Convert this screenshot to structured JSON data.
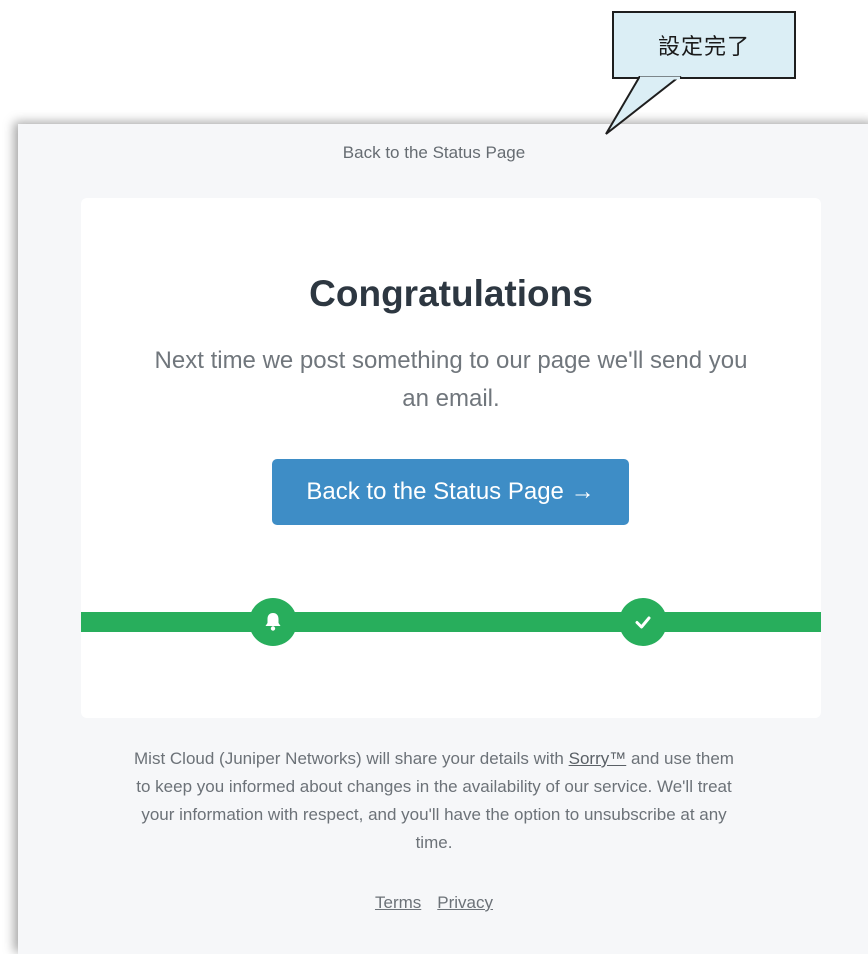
{
  "annotation": {
    "label": "設定完了"
  },
  "header": {
    "back_link": "Back to the Status Page"
  },
  "card": {
    "title": "Congratulations",
    "message": "Next time we post something to our page we'll send you an email.",
    "button_label": "Back to the Status Page →"
  },
  "progress": {
    "color": "#28ae5c",
    "steps": [
      {
        "icon": "bell-icon"
      },
      {
        "icon": "check-icon"
      }
    ]
  },
  "footer": {
    "text_before": "Mist Cloud (Juniper Networks) will share your details with ",
    "sorry_link": "Sorry™",
    "text_after": " and use them to keep you informed about changes in the availability of our service. We'll treat your information with respect, and you'll have the option to unsubscribe at any time.",
    "terms": "Terms",
    "privacy": "Privacy"
  },
  "colors": {
    "accent": "#3e8dc6",
    "success": "#28ae5c",
    "callout_bg": "#dbeef5"
  }
}
